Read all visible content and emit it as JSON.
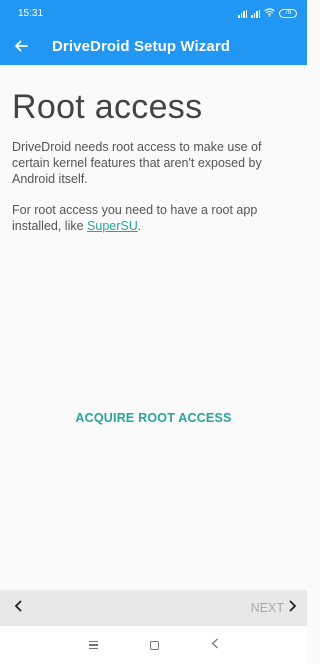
{
  "status_bar": {
    "time": "15:31",
    "battery": "78"
  },
  "app_bar": {
    "title": "DriveDroid Setup Wizard"
  },
  "content": {
    "heading": "Root access",
    "paragraph1": "DriveDroid needs root access to make use of certain kernel features that aren't exposed by Android itself.",
    "paragraph2_prefix": "For root access you need to have a root app installed, like ",
    "link_text": "SuperSU",
    "paragraph2_suffix": "."
  },
  "actions": {
    "acquire_label": "ACQUIRE ROOT ACCESS"
  },
  "wizard_nav": {
    "next_label": "NEXT"
  },
  "colors": {
    "primary": "#2196f3",
    "accent": "#26a69a"
  },
  "icons": {
    "back": "arrow-left-icon",
    "prev": "chevron-left-icon",
    "next": "chevron-right-icon"
  }
}
